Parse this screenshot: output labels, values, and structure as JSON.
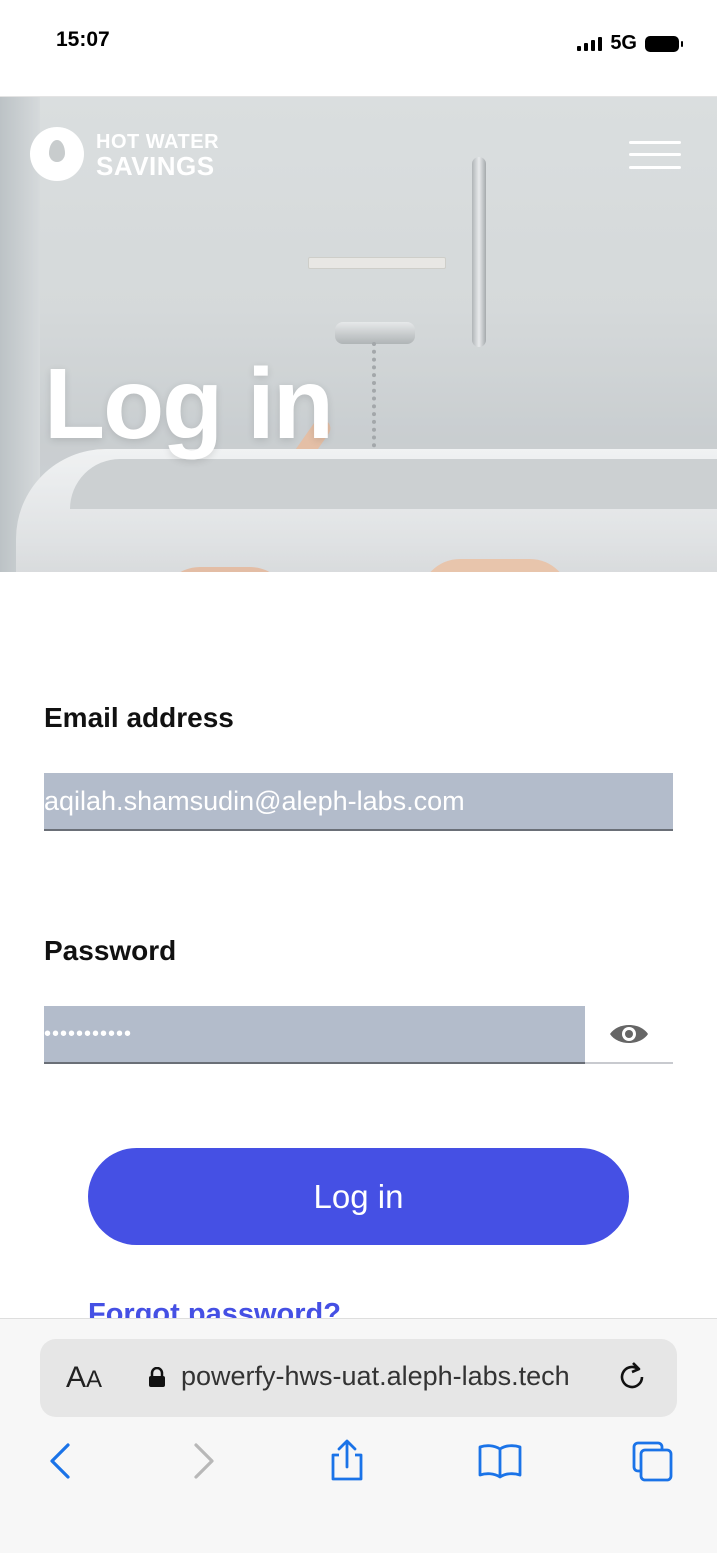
{
  "status_bar": {
    "time": "15:07",
    "network": "5G"
  },
  "header": {
    "logo_line1": "HOT WATER",
    "logo_line2": "SAVINGS"
  },
  "hero": {
    "title": "Log in"
  },
  "form": {
    "email_label": "Email address",
    "email_value": "aqilah.shamsudin@aleph-labs.com",
    "password_label": "Password",
    "password_mask": "•••••••••••",
    "login_label": "Log in",
    "forgot_label": "Forgot password?"
  },
  "browser": {
    "text_size_label_big": "A",
    "text_size_label_small": "A",
    "url": "powerfy-hws-uat.aleph-labs.tech"
  },
  "colors": {
    "accent": "#4550e4",
    "input_fill": "#b3bccb"
  },
  "icons": [
    "menu-icon",
    "eye-icon",
    "lock-icon",
    "reload-icon",
    "back-icon",
    "forward-icon",
    "share-icon",
    "bookmarks-icon",
    "tabs-icon"
  ]
}
